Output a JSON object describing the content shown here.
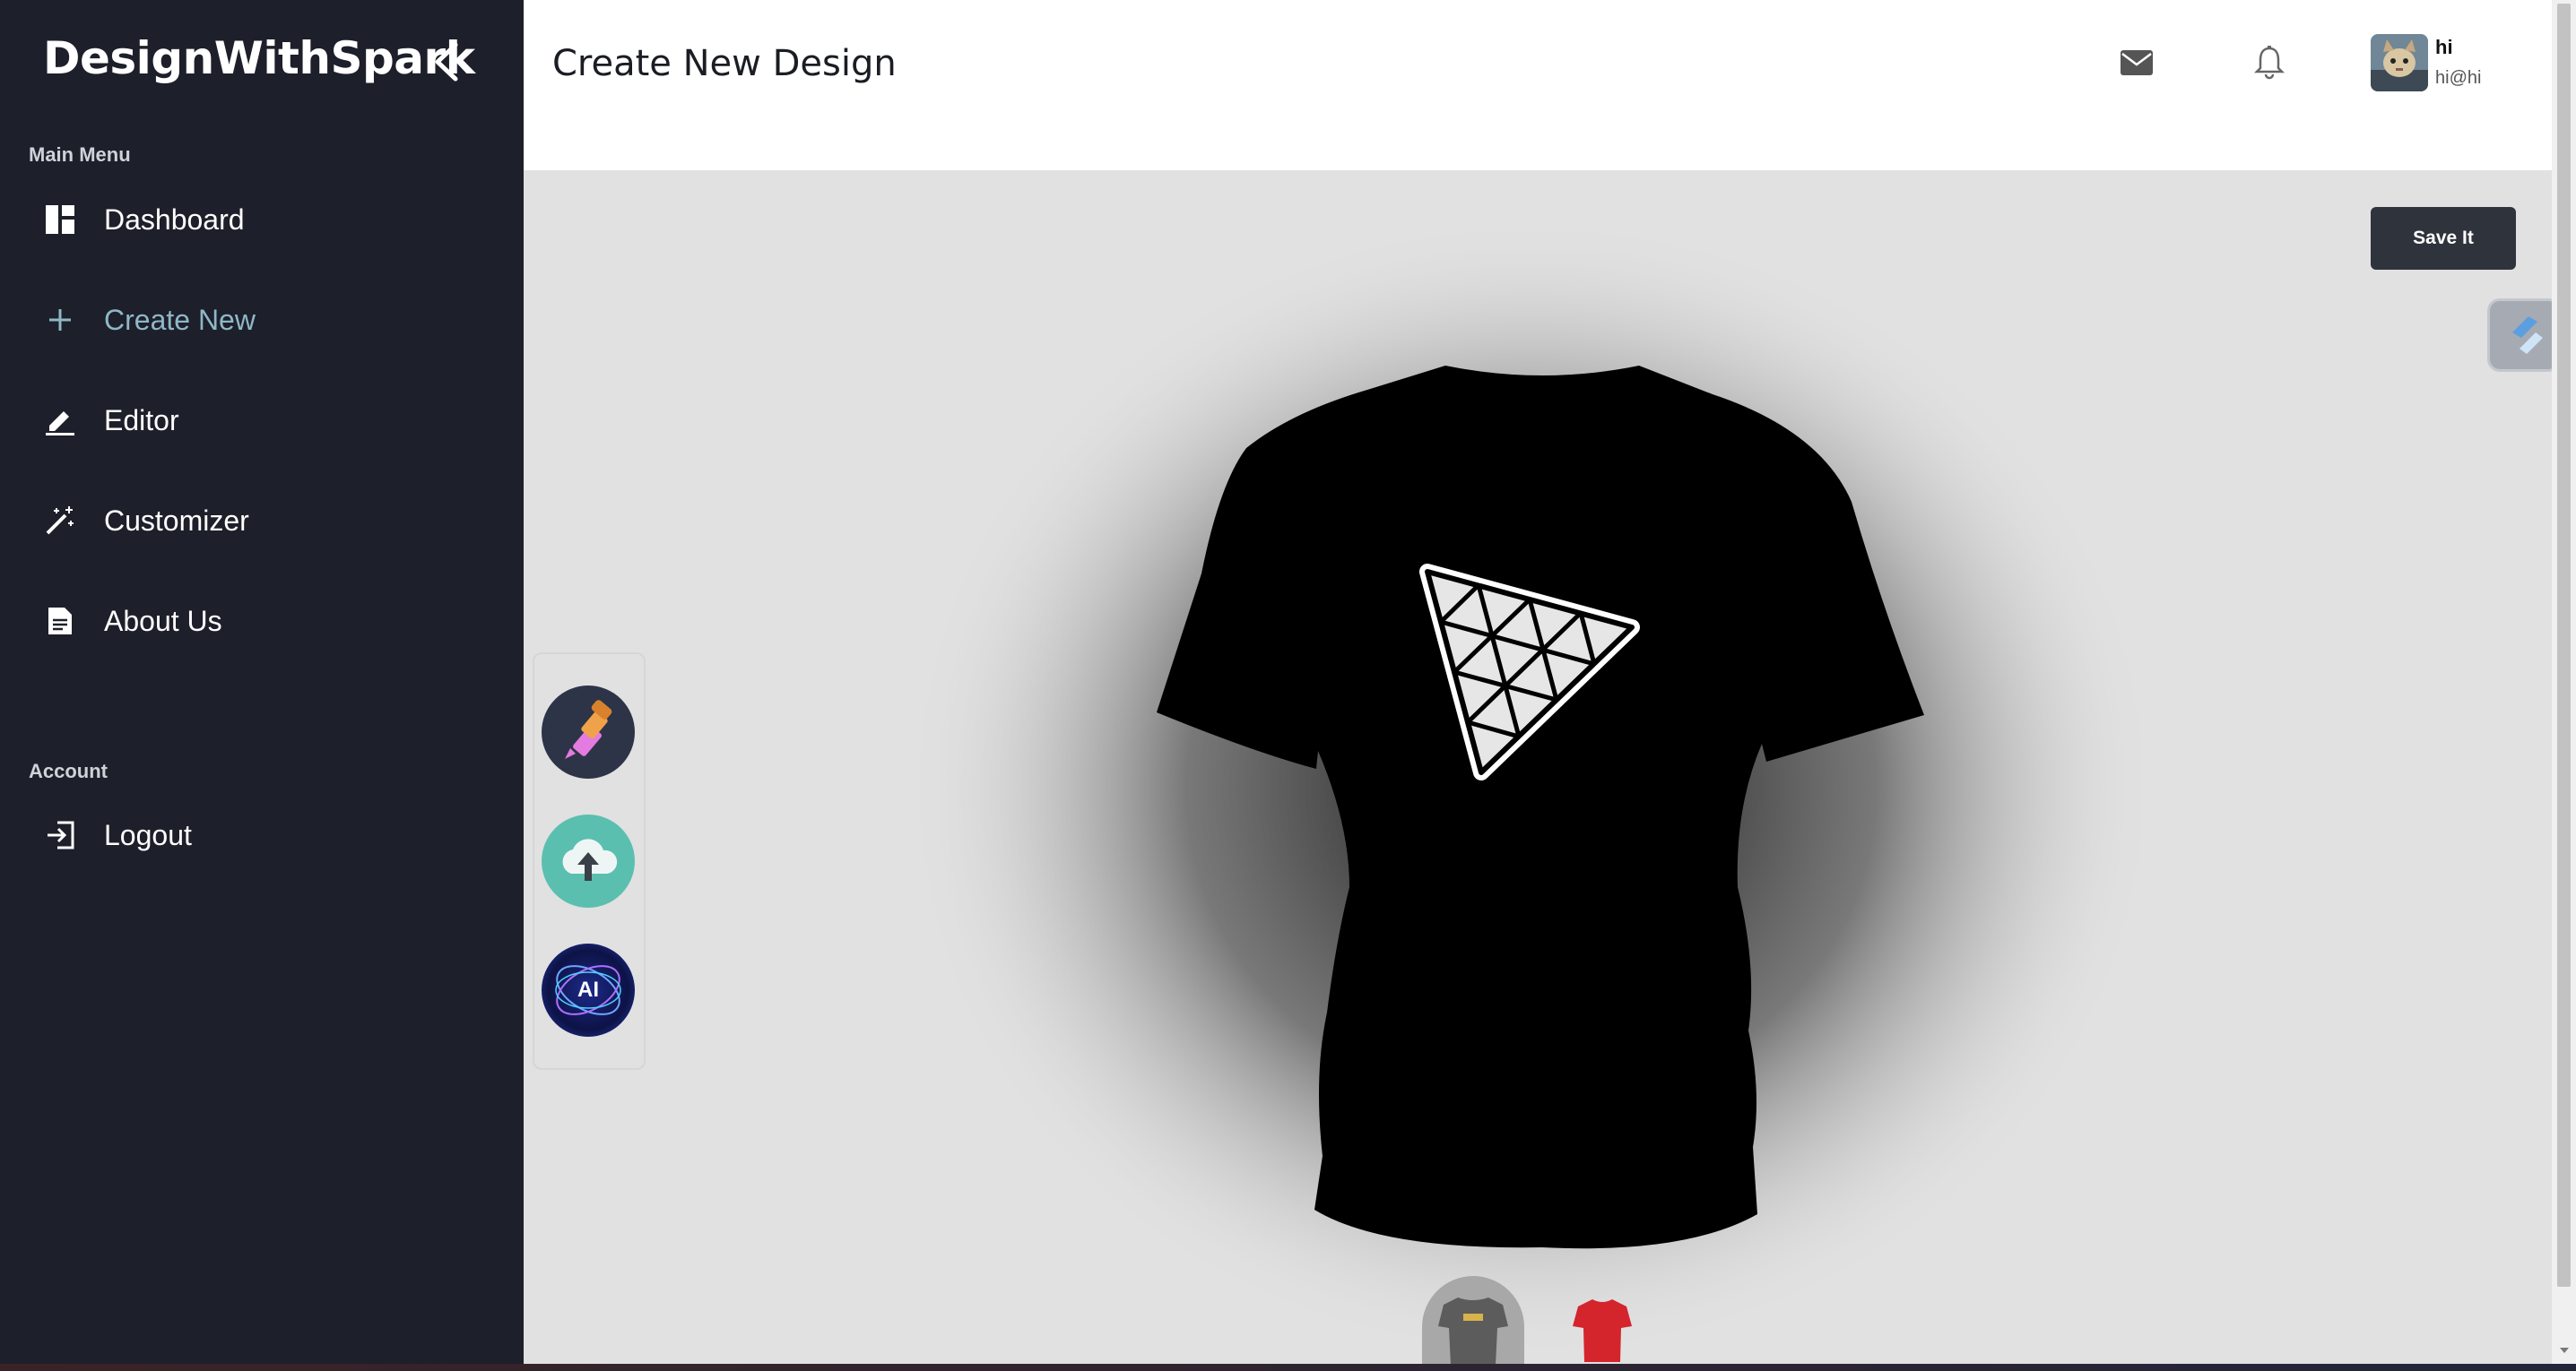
{
  "app": {
    "brand": "DesignWithSpark"
  },
  "sidebar": {
    "main_menu_label": "Main Menu",
    "items": [
      {
        "label": "Dashboard",
        "icon": "dashboard-icon"
      },
      {
        "label": "Create New",
        "icon": "plus-icon",
        "active": true
      },
      {
        "label": "Editor",
        "icon": "edit-icon"
      },
      {
        "label": "Customizer",
        "icon": "magic-wand-icon"
      },
      {
        "label": "About Us",
        "icon": "document-icon"
      }
    ],
    "account_label": "Account",
    "logout_label": "Logout"
  },
  "header": {
    "title": "Create New Design",
    "user": {
      "name": "hi",
      "email": "hi@hi"
    }
  },
  "workspace": {
    "save_label": "Save It",
    "tools": [
      {
        "name": "color-picker",
        "icon": "eyedropper-icon"
      },
      {
        "name": "upload",
        "icon": "cloud-upload-icon"
      },
      {
        "name": "ai",
        "label": "AI",
        "icon": "ai-icon"
      }
    ],
    "shirt_color": "#000000",
    "variants": [
      {
        "name": "gray-shirt",
        "color": "#5c5c5c",
        "selected": true
      },
      {
        "name": "red-shirt",
        "color": "#d4242c"
      }
    ]
  },
  "colors": {
    "sidebar_bg": "#1d1f2a",
    "active_item": "#8fb7c6",
    "button_bg": "#2f333c"
  }
}
